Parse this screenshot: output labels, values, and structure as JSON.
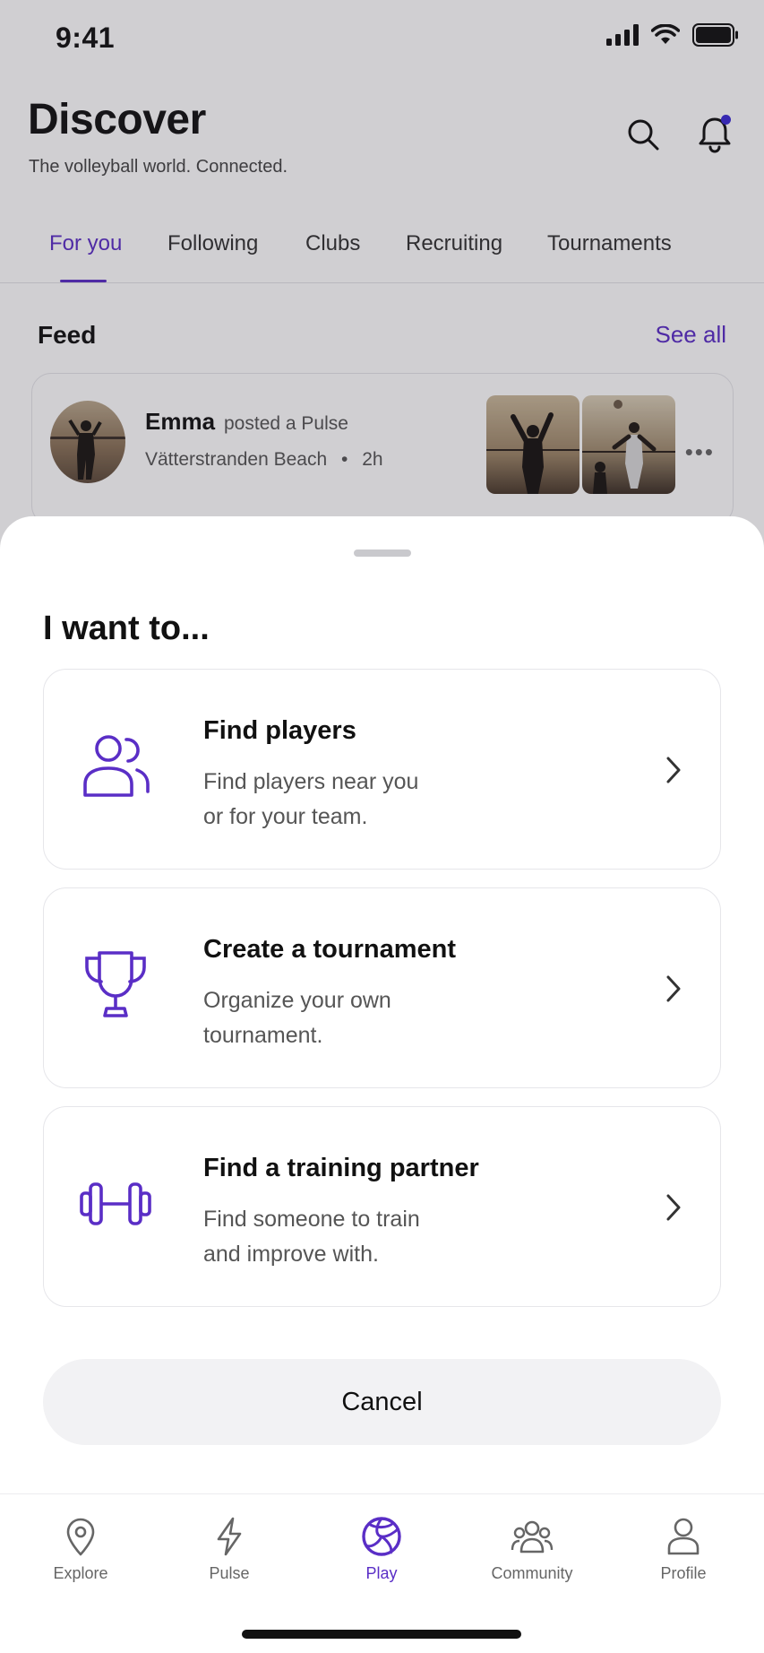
{
  "status_bar": {
    "time": "9:41"
  },
  "header": {
    "title": "Discover",
    "subtitle": "The volleyball world. Connected."
  },
  "tabs": [
    {
      "label": "For you",
      "active": true
    },
    {
      "label": "Following"
    },
    {
      "label": "Clubs"
    },
    {
      "label": "Recruiting"
    },
    {
      "label": "Tournaments"
    }
  ],
  "feed": {
    "title": "Feed",
    "see_all": "See all",
    "post": {
      "name": "Emma",
      "action": "posted a Pulse",
      "location": "Vätterstranden Beach",
      "time": "2h"
    }
  },
  "sheet": {
    "title": "I want to...",
    "options": [
      {
        "icon": "players-icon",
        "title": "Find players",
        "desc_line1": "Find players near you",
        "desc_line2": "or for your team."
      },
      {
        "icon": "trophy-icon",
        "title": "Create a tournament",
        "desc_line1": "Organize your own",
        "desc_line2": "tournament."
      },
      {
        "icon": "dumbbell-icon",
        "title": "Find a training partner",
        "desc_line1": "Find someone to train",
        "desc_line2": "and improve with."
      }
    ],
    "cancel": "Cancel"
  },
  "tab_bar": [
    {
      "label": "Explore",
      "icon": "map-pin-icon"
    },
    {
      "label": "Pulse",
      "icon": "bolt-icon"
    },
    {
      "label": "Play",
      "icon": "volleyball-icon",
      "active": true
    },
    {
      "label": "Community",
      "icon": "community-icon"
    },
    {
      "label": "Profile",
      "icon": "user-icon"
    }
  ],
  "colors": {
    "accent": "#5a2ec6",
    "notification": "#3b2bd6"
  }
}
